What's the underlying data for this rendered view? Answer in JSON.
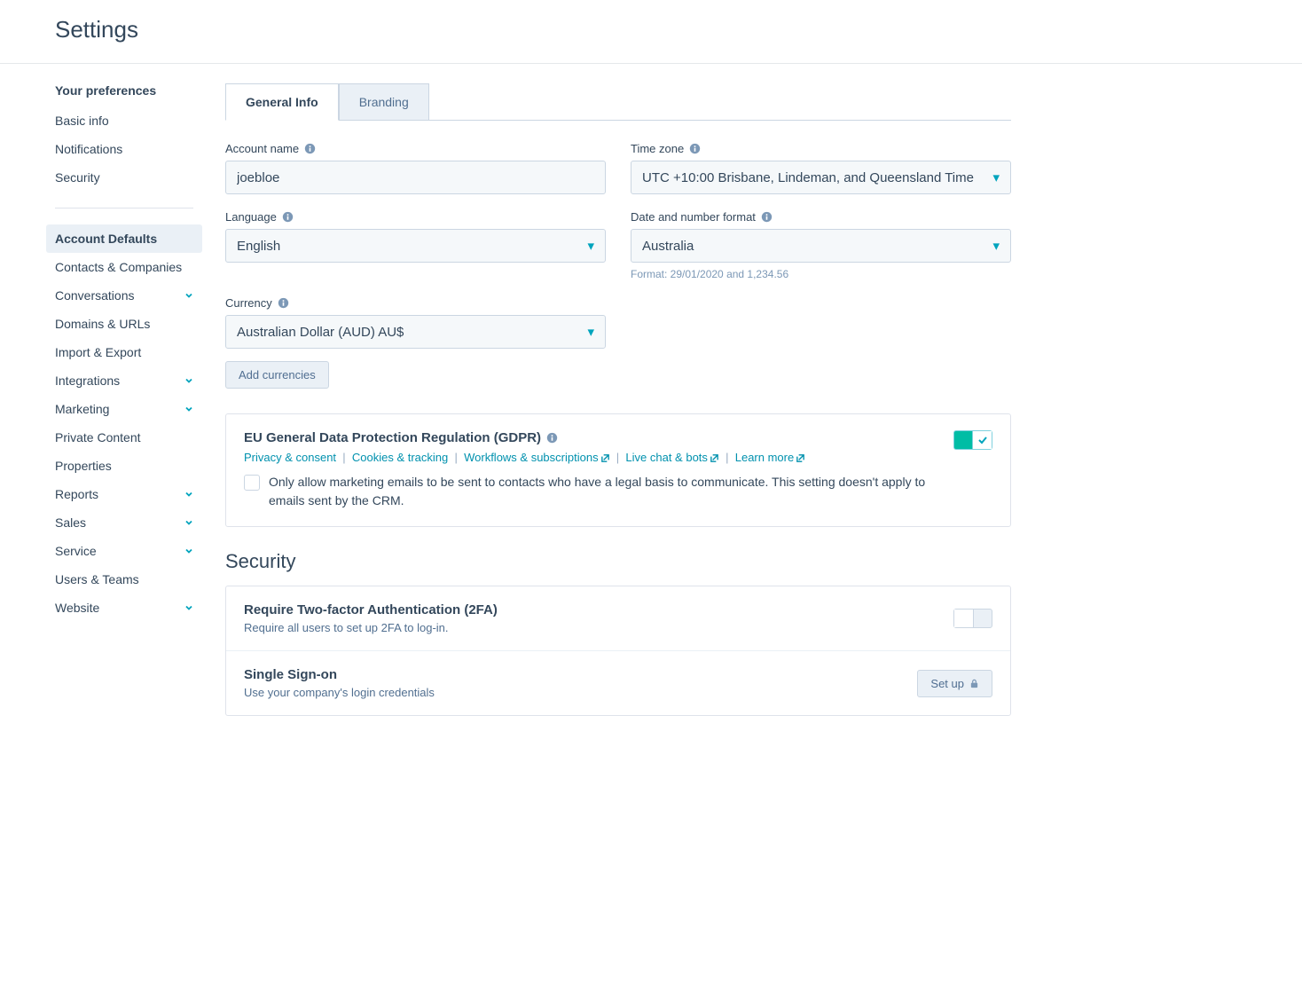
{
  "header": {
    "title": "Settings"
  },
  "sidebar": {
    "prefs_heading": "Your preferences",
    "prefs": [
      {
        "label": "Basic info"
      },
      {
        "label": "Notifications"
      },
      {
        "label": "Security"
      }
    ],
    "main": [
      {
        "label": "Account Defaults",
        "active": true
      },
      {
        "label": "Contacts & Companies"
      },
      {
        "label": "Conversations",
        "expandable": true
      },
      {
        "label": "Domains & URLs"
      },
      {
        "label": "Import & Export"
      },
      {
        "label": "Integrations",
        "expandable": true
      },
      {
        "label": "Marketing",
        "expandable": true
      },
      {
        "label": "Private Content"
      },
      {
        "label": "Properties"
      },
      {
        "label": "Reports",
        "expandable": true
      },
      {
        "label": "Sales",
        "expandable": true
      },
      {
        "label": "Service",
        "expandable": true
      },
      {
        "label": "Users & Teams"
      },
      {
        "label": "Website",
        "expandable": true
      }
    ]
  },
  "tabs": [
    {
      "label": "General Info",
      "active": true
    },
    {
      "label": "Branding"
    }
  ],
  "form": {
    "account_name": {
      "label": "Account name",
      "value": "joebloe"
    },
    "timezone": {
      "label": "Time zone",
      "value": "UTC +10:00 Brisbane, Lindeman, and Queensland Time"
    },
    "language": {
      "label": "Language",
      "value": "English"
    },
    "date_format": {
      "label": "Date and number format",
      "value": "Australia",
      "helper": "Format: 29/01/2020 and 1,234.56"
    },
    "currency": {
      "label": "Currency",
      "value": "Australian Dollar (AUD) AU$"
    },
    "add_currencies": "Add currencies"
  },
  "gdpr": {
    "title": "EU General Data Protection Regulation (GDPR)",
    "links": {
      "privacy": "Privacy & consent",
      "cookies": "Cookies & tracking",
      "workflows": "Workflows & subscriptions",
      "livechat": "Live chat & bots",
      "learnmore": "Learn more"
    },
    "checkbox_text": "Only allow marketing emails to be sent to contacts who have a legal basis to communicate. This setting doesn't apply to emails sent by the CRM."
  },
  "security": {
    "heading": "Security",
    "twofa": {
      "title": "Require Two-factor Authentication (2FA)",
      "desc": "Require all users to set up 2FA to log-in."
    },
    "sso": {
      "title": "Single Sign-on",
      "desc": "Use your company's login credentials",
      "button": "Set up"
    }
  }
}
